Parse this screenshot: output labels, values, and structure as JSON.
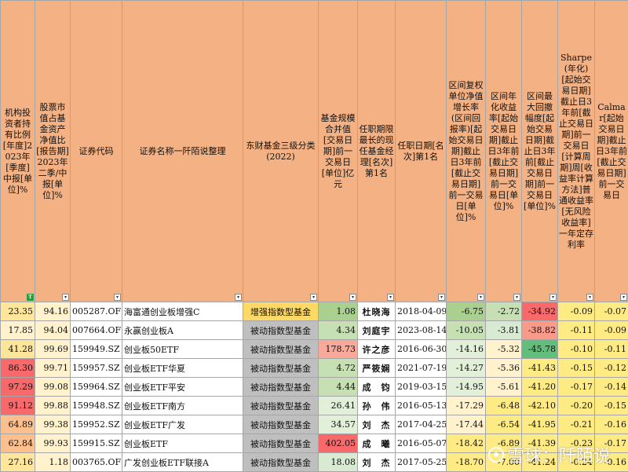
{
  "colors": {
    "header_bg": "#f4b183",
    "grey_cell": "#bfbfbf",
    "yellow_cell": "#fff2cc",
    "green_filter": "#2e9c3e"
  },
  "headers": [
    "机构投资者持有比例[年度]2023年[季度]中报[单位]%",
    "股票市值占基金资产净值比[报告期]2023年二季/中报[单位]%",
    "证券代码",
    "证券名称一阡陌说整理",
    "东财基金三级分类(2022)",
    "基金规模合并值[交易日期]前一交易日[单位]亿元",
    "任职期限最长的现任基金经理[名次]第1名",
    "任职日期[名次]第1名",
    "区间复权单位净值增长率(区间回报率)[起始交易日期]截止日3年前[截止交易日期]前一交易日[单位]%",
    "区间年化收益率[起始交易日期]截止日3年前[截止交易日期]前一交易日[单位]%",
    "区间最大回撤幅度[起始交易日期]截止日3年前[截止交易日期]前一交易日[单位]%",
    "Sharpe(年化)[起始交易日期]截止日3年前[截止交易日期]前一交易日[计算周期]周[收益率计算方法]普通收益率[无风险收益率]一年定存利率",
    "Calmar[起始交易日期]截止日3年前[截止交易日期]前一交易日"
  ],
  "filter_icons": [
    "green-filter",
    "filter",
    "filter",
    "filter",
    "filter",
    "filter",
    "filter",
    "filter",
    "filter",
    "filter",
    "filter",
    "filter",
    "filter"
  ],
  "filter_glyph_green": "T",
  "filter_glyph": "▾",
  "rows": [
    {
      "cells": [
        "23.35",
        "94.16",
        "005287.OF",
        "海富通创业板增强C",
        "增强指数型基金",
        "1.08",
        "杜晓海",
        "2018-04-09",
        "-6.75",
        "-2.72",
        "-34.92",
        "-0.09",
        "-0.07"
      ],
      "colors": [
        "#ffe699",
        "#fff2cc",
        "#ffffff",
        "#ffffff",
        "#ffd966",
        "#a9d08e",
        "#ffffff",
        "#ffffff",
        "#a9d08e",
        "#c6e0b4",
        "#f8696b",
        "#ffeb84",
        "#ffeb84"
      ]
    },
    {
      "cells": [
        "17.85",
        "94.04",
        "007664.OF",
        "永赢创业板A",
        "被动指数型基金",
        "4.34",
        "刘庭宇",
        "2023-08-14",
        "-10.05",
        "-3.81",
        "-38.82",
        "-0.11",
        "-0.09"
      ],
      "colors": [
        "#fff2cc",
        "#fff2cc",
        "#ffffff",
        "#ffffff",
        "#bfbfbf",
        "#c6e0b4",
        "#ffffff",
        "#ffffff",
        "#c6e0b4",
        "#d9ead3",
        "#fa9a8b",
        "#ffeb84",
        "#ffeb84"
      ]
    },
    {
      "cells": [
        "41.28",
        "99.69",
        "159949.SZ",
        "创业板50ETF",
        "被动指数型基金",
        "178.73",
        "许之彦",
        "2016-06-30",
        "-14.16",
        "-5.32",
        "-45.78",
        "-0.10",
        "-0.11"
      ],
      "colors": [
        "#fde59a",
        "#fff2cc",
        "#ffffff",
        "#ffffff",
        "#bfbfbf",
        "#f8a99a",
        "#ffffff",
        "#ffffff",
        "#e2efd9",
        "#fff2cc",
        "#63be7b",
        "#ffeb84",
        "#ffeb84"
      ]
    },
    {
      "cells": [
        "86.30",
        "99.71",
        "159957.SZ",
        "创业板ETF华夏",
        "被动指数型基金",
        "4.72",
        "严筱娴",
        "2021-07-19",
        "-14.27",
        "-5.36",
        "-41.43",
        "-0.15",
        "-0.12"
      ],
      "colors": [
        "#f8696b",
        "#fff2cc",
        "#ffffff",
        "#ffffff",
        "#bfbfbf",
        "#c6e0b4",
        "#ffffff",
        "#ffffff",
        "#e2efd9",
        "#fff2cc",
        "#ffeb84",
        "#ffeb84",
        "#ffeb84"
      ]
    },
    {
      "cells": [
        "97.29",
        "99.08",
        "159964.SZ",
        "创业板ETF平安",
        "被动指数型基金",
        "4.44",
        "成　钧",
        "2019-03-15",
        "-14.95",
        "-5.61",
        "-41.20",
        "-0.17",
        "-0.14"
      ],
      "colors": [
        "#f8696b",
        "#fff2cc",
        "#ffffff",
        "#ffffff",
        "#bfbfbf",
        "#c6e0b4",
        "#ffffff",
        "#ffffff",
        "#e2efd9",
        "#fff2cc",
        "#ffeb84",
        "#ffeb84",
        "#ffeb84"
      ]
    },
    {
      "cells": [
        "91.12",
        "99.88",
        "159948.SZ",
        "创业板ETF南方",
        "被动指数型基金",
        "26.41",
        "孙　伟",
        "2016-05-13",
        "-17.29",
        "-6.48",
        "-42.10",
        "-0.20",
        "-0.15"
      ],
      "colors": [
        "#f8696b",
        "#fff2cc",
        "#ffffff",
        "#ffffff",
        "#bfbfbf",
        "#e2efd9",
        "#ffffff",
        "#ffffff",
        "#fff2cc",
        "#ffeb84",
        "#ffeb84",
        "#ffeb84",
        "#ffeb84"
      ]
    },
    {
      "cells": [
        "64.89",
        "99.38",
        "159952.SZ",
        "创业板ETF广发",
        "被动指数型基金",
        "34.57",
        "刘　杰",
        "2017-04-25",
        "-17.44",
        "-6.54",
        "-41.95",
        "-0.21",
        "-0.16"
      ],
      "colors": [
        "#fbc08e",
        "#fff2cc",
        "#ffffff",
        "#ffffff",
        "#bfbfbf",
        "#e2efd9",
        "#ffffff",
        "#ffffff",
        "#fff2cc",
        "#ffeb84",
        "#ffeb84",
        "#ffeb84",
        "#ffeb84"
      ]
    },
    {
      "cells": [
        "62.84",
        "99.93",
        "159915.SZ",
        "创业板ETF",
        "被动指数型基金",
        "402.05",
        "成　曦",
        "2016-05-07",
        "-18.42",
        "-6.89",
        "-41.39",
        "-0.23",
        "-0.17"
      ],
      "colors": [
        "#fbc08e",
        "#fff2cc",
        "#ffffff",
        "#ffffff",
        "#bfbfbf",
        "#f8696b",
        "#ffffff",
        "#ffffff",
        "#ffeb84",
        "#ffeb84",
        "#ffeb84",
        "#ffeb84",
        "#ffeb84"
      ]
    },
    {
      "cells": [
        "27.16",
        "1.18",
        "003765.OF",
        "广发创业板ETF联接A",
        "被动指数型基金",
        "18.08",
        "刘　杰",
        "2017-05-25",
        "-18.70",
        "-7.00",
        "-41.24",
        "-0.24",
        "-0.16"
      ],
      "colors": [
        "#ffe699",
        "#fff2cc",
        "#ffffff",
        "#ffffff",
        "#bfbfbf",
        "#d9ead3",
        "#ffffff",
        "#ffffff",
        "#ffeb84",
        "#ffeb84",
        "#ffeb84",
        "#ffeb84",
        "#ffeb84"
      ]
    }
  ],
  "watermark": {
    "text": "雪球：阡陌说",
    "icon": "snowball-logo-icon"
  }
}
